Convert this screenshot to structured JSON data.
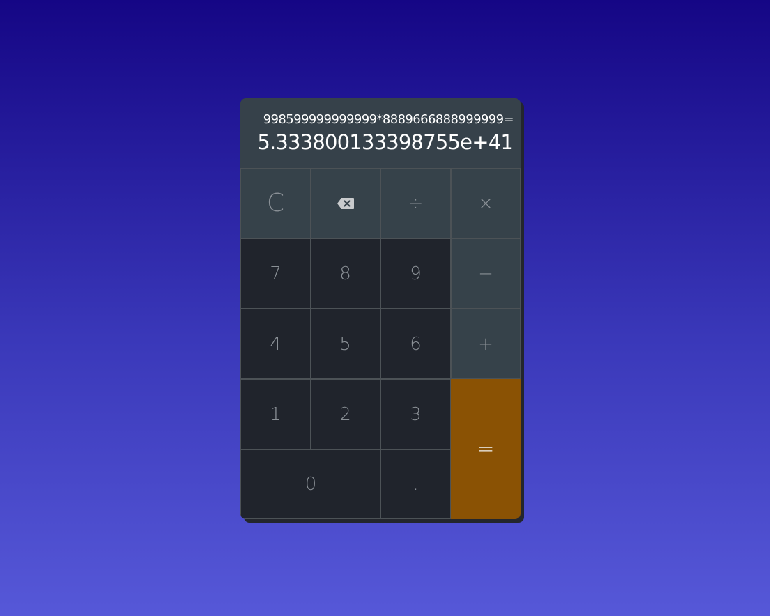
{
  "display": {
    "expression": "998599999999999*8889666888999999=",
    "result": "5.333800133398755e+41"
  },
  "keys": {
    "clear": "C",
    "divide": "÷",
    "multiply": "×",
    "subtract": "−",
    "add": "+",
    "equals": "=",
    "decimal": ".",
    "d0": "0",
    "d1": "1",
    "d2": "2",
    "d3": "3",
    "d4": "4",
    "d5": "5",
    "d6": "6",
    "d7": "7",
    "d8": "8",
    "d9": "9"
  },
  "icons": {
    "backspace": "backspace-icon"
  },
  "colors": {
    "background_top": "#150685",
    "background_bottom": "#5658d8",
    "display": "#36414a",
    "function_key": "#36424a",
    "number_key": "#20242c",
    "equals_key": "#8a5204",
    "key_text": "#8a9096"
  }
}
